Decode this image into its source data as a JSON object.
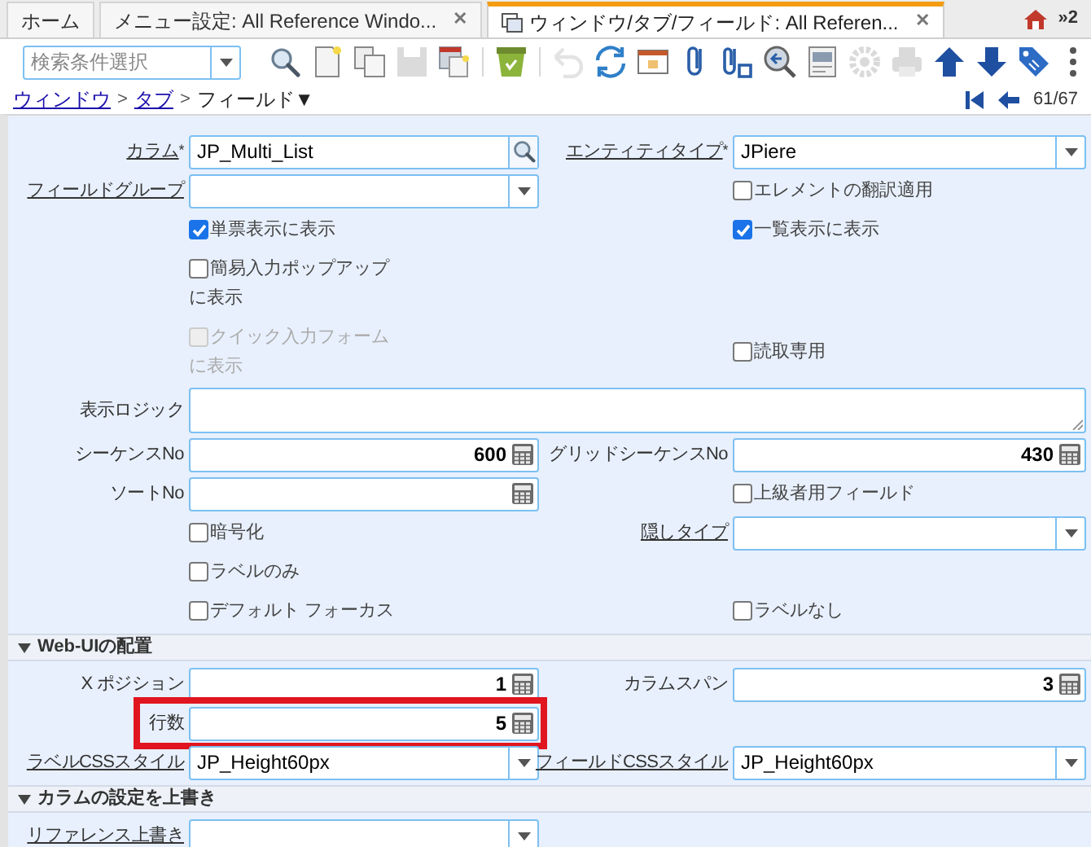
{
  "tabs": [
    {
      "label": "ホーム",
      "selected": false
    },
    {
      "label": "メニュー設定: All Reference Windo...",
      "selected": false,
      "close": "✕"
    },
    {
      "label": "ウィンドウ/タブ/フィールド: All Referen...",
      "selected": true,
      "close": "✕"
    }
  ],
  "tab_overflow": {
    "label": "»2"
  },
  "toolbar": {
    "search": {
      "placeholder": "検索条件選択"
    },
    "buttons": [
      {
        "kind": "search",
        "disabled": false
      },
      {
        "kind": "new",
        "disabled": false
      },
      {
        "kind": "copy",
        "disabled": false
      },
      {
        "kind": "save",
        "disabled": true
      },
      {
        "kind": "save-new",
        "disabled": false
      },
      {
        "kind": "separator"
      },
      {
        "kind": "delete",
        "disabled": false
      },
      {
        "kind": "separator"
      },
      {
        "kind": "undo",
        "disabled": true
      },
      {
        "kind": "refresh",
        "disabled": false
      },
      {
        "kind": "grid",
        "disabled": false
      },
      {
        "kind": "attach",
        "disabled": false
      },
      {
        "kind": "attach-chat",
        "disabled": false
      },
      {
        "kind": "zoom",
        "disabled": false
      },
      {
        "kind": "report",
        "disabled": false
      },
      {
        "kind": "gear",
        "disabled": true
      },
      {
        "kind": "print",
        "disabled": true
      },
      {
        "kind": "up",
        "disabled": false
      },
      {
        "kind": "down",
        "disabled": false
      },
      {
        "kind": "tag",
        "disabled": false
      },
      {
        "kind": "more",
        "disabled": false
      }
    ]
  },
  "breadcrumb": {
    "items": [
      {
        "label": "ウィンドウ",
        "link": true
      },
      {
        "label": "タブ",
        "link": true
      },
      {
        "label": "フィールド▼",
        "link": false
      }
    ],
    "separator": ">",
    "position": "61/67"
  },
  "sections": [
    {
      "rows": [
        {
          "left": {
            "kind": "lookup",
            "label": "カラム",
            "link": true,
            "required": "*",
            "value": "JP_Multi_List"
          },
          "right": {
            "kind": "select",
            "label": "エンティティタイプ",
            "link": true,
            "required": "*",
            "value": "JPiere"
          }
        },
        {
          "left": {
            "kind": "select",
            "label": "フィールドグループ",
            "link": true
          },
          "right": {
            "kind": "checkbox",
            "label": "エレメントの翻訳適用",
            "checked": false,
            "disabled": false
          }
        },
        {
          "left": {
            "kind": "checkbox",
            "label": "単票表示に表示",
            "checked": true,
            "disabled": false
          },
          "right": {
            "kind": "checkbox",
            "label": "一覧表示に表示",
            "checked": true,
            "disabled": false
          }
        },
        {
          "left": {
            "kind": "checkbox",
            "label": "簡易入力ポップアップ",
            "label_continued": "に表示",
            "checked": false,
            "disabled": false
          }
        },
        {
          "left": {
            "kind": "checkbox",
            "label": "クイック入力フォーム",
            "label_continued": "に表示",
            "checked": false,
            "disabled": true
          },
          "right": {
            "kind": "checkbox",
            "label": "読取専用",
            "checked": false,
            "disabled": false
          }
        },
        {
          "full": {
            "kind": "textarea",
            "label": "表示ロジック",
            "link": false
          }
        },
        {
          "left": {
            "kind": "number",
            "label": "シーケンスNo",
            "link": false,
            "value": "600"
          },
          "right": {
            "kind": "number",
            "label": "グリッドシーケンスNo",
            "link": false,
            "value": "430"
          }
        },
        {
          "left": {
            "kind": "number",
            "label": "ソートNo",
            "link": false
          },
          "right": {
            "kind": "checkbox",
            "label": "上級者用フィールド",
            "checked": false,
            "disabled": false
          }
        },
        {
          "left": {
            "kind": "checkbox",
            "label": "暗号化",
            "checked": false,
            "disabled": false
          },
          "right": {
            "kind": "select",
            "label": "隠しタイプ",
            "link": true
          }
        },
        {
          "left": {
            "kind": "checkbox",
            "label": "ラベルのみ",
            "checked": false,
            "disabled": false
          }
        },
        {
          "left": {
            "kind": "checkbox",
            "label": "デフォルト フォーカス",
            "checked": false,
            "disabled": false
          },
          "right": {
            "kind": "checkbox",
            "label": "ラベルなし",
            "checked": false,
            "disabled": false
          }
        }
      ]
    },
    {
      "title": "Web-UIの配置",
      "expanded": true,
      "rows": [
        {
          "left": {
            "kind": "number",
            "label": "X ポジション",
            "link": false,
            "value": "1"
          },
          "right": {
            "kind": "number",
            "label": "カラムスパン",
            "link": false,
            "value": "3"
          }
        },
        {
          "left": {
            "kind": "number",
            "label": "行数",
            "link": false,
            "value": "5",
            "highlighted": true
          }
        },
        {
          "left": {
            "kind": "select",
            "label": "ラベルCSSスタイル",
            "link": true,
            "value": "JP_Height60px"
          },
          "right": {
            "kind": "select",
            "label": "フィールドCSSスタイル",
            "link": true,
            "value": "JP_Height60px"
          }
        }
      ]
    },
    {
      "title": "カラムの設定を上書き",
      "expanded": true,
      "rows": [
        {
          "left": {
            "kind": "select",
            "label": "リファレンス上書き",
            "link": true
          }
        }
      ]
    }
  ]
}
